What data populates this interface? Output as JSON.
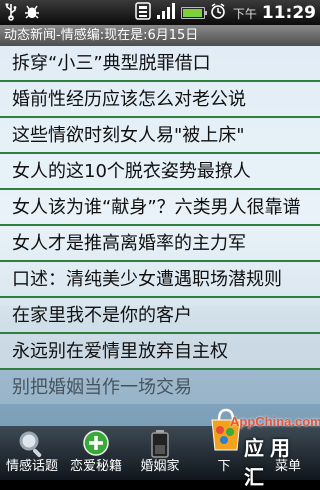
{
  "status_bar": {
    "ampm": "下午",
    "time": "11:29",
    "icons": [
      "usb-icon",
      "debug-icon",
      "wifi-icon",
      "signal-icon",
      "battery-icon",
      "alarm-icon"
    ],
    "battery_level": 0.85
  },
  "title_strip": {
    "text": "动态新闻-情感编:现在是:6月15日"
  },
  "articles": [
    "拆穿“小三”典型脱罪借口",
    "婚前性经历应该怎么对老公说",
    "这些情欲时刻女人易\"被上床\"",
    "女人的这10个脱衣姿势最撩人",
    "女人该为谁“献身”？六类男人很靠谱",
    "女人才是推高离婚率的主力军",
    "口述：清纯美少女遭遇职场潜规则",
    "在家里我不是你的客户",
    "永远别在爱情里放弃自主权",
    "别把婚姻当作一场交易"
  ],
  "tabs": [
    {
      "label": "情感话题",
      "icon": "magnifier-icon"
    },
    {
      "label": "恋爱秘籍",
      "icon": "plus-icon"
    },
    {
      "label": "婚姻家",
      "icon": "battery-icon"
    },
    {
      "label": "下",
      "icon": ""
    },
    {
      "label": "菜单",
      "icon": ""
    }
  ],
  "watermark": {
    "brand": "AppChina.com",
    "big": "应用汇"
  },
  "colors": {
    "divider": "#2f7f3f",
    "battery_green": "#7cd23a",
    "plus_green": "#3aa83a",
    "watermark_red": "#e8553c"
  }
}
